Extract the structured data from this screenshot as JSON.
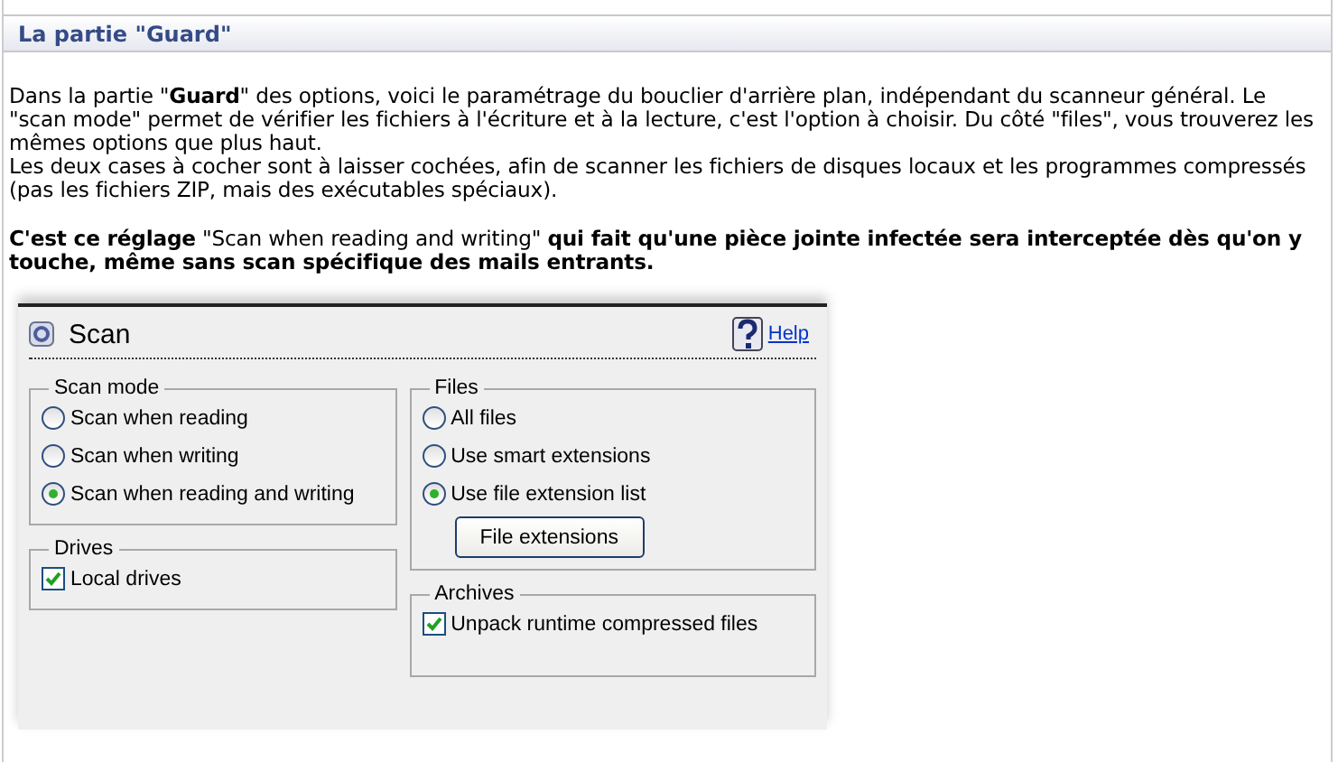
{
  "section": {
    "title": "La partie \"Guard\""
  },
  "paragraphs": [
    "Dans la partie \"**Guard**\" des options, voici le paramétrage du bouclier d'arrière plan, indépendant du scanneur général. Le \"scan mode\" permet de vérifier les fichiers à l'écriture et à la lecture, c'est l'option à choisir. Du côté \"files\", vous trouverez les mêmes options que plus haut.",
    "Les deux cases à cocher sont à laisser cochées, afin de scanner les fichiers de disques locaux et les programmes compressés (pas les fichiers ZIP, mais des exécutables spéciaux)."
  ],
  "note": "**C'est ce réglage** \"Scan when reading and writing\" **qui fait qu'une pièce jointe infectée sera interceptée dès qu'on y touche, même sans scan spécifique des mails entrants.**",
  "dialog": {
    "title": "Scan",
    "help": "Help",
    "left_groups": [
      {
        "title": "Scan mode",
        "items": [
          {
            "kind": "radio",
            "label": "Scan when reading",
            "selected": false
          },
          {
            "kind": "radio",
            "label": "Scan when writing",
            "selected": false
          },
          {
            "kind": "radio",
            "label": "Scan when reading and writing",
            "selected": true
          }
        ]
      },
      {
        "title": "Drives",
        "items": [
          {
            "kind": "checkbox",
            "label": "Local drives",
            "checked": true
          }
        ]
      }
    ],
    "right_groups": [
      {
        "title": "Files",
        "items": [
          {
            "kind": "radio",
            "label": "All files",
            "selected": false
          },
          {
            "kind": "radio",
            "label": "Use smart extensions",
            "selected": false
          },
          {
            "kind": "radio",
            "label": "Use file extension list",
            "selected": true
          },
          {
            "kind": "button",
            "label": "File extensions"
          }
        ]
      },
      {
        "title": "Archives",
        "items": [
          {
            "kind": "checkbox",
            "label": "Unpack runtime compressed files",
            "checked": true
          }
        ]
      }
    ]
  }
}
